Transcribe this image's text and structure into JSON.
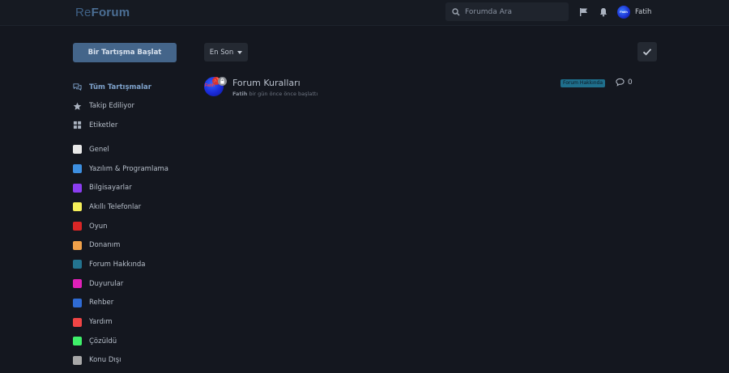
{
  "header": {
    "logo_re": "Re",
    "logo_forum": "Forum",
    "search_placeholder": "Forumda Ara",
    "user_name": "Fatih",
    "avatar_text": "Fatih"
  },
  "sidebar": {
    "start_button": "Bir Tartışma Başlat",
    "nav": [
      {
        "label": "Tüm Tartışmalar",
        "icon": "comments-icon",
        "active": true
      },
      {
        "label": "Takip Ediliyor",
        "icon": "star-icon",
        "active": false
      },
      {
        "label": "Etiketler",
        "icon": "grid-icon",
        "active": false
      }
    ],
    "tags": [
      {
        "label": "Genel",
        "color": "#e8e8e8"
      },
      {
        "label": "Yazılım & Programlama",
        "color": "#3d8fe0"
      },
      {
        "label": "Bilgisayarlar",
        "color": "#8b3df0"
      },
      {
        "label": "Akıllı Telefonlar",
        "color": "#f5ef5a"
      },
      {
        "label": "Oyun",
        "color": "#d92626"
      },
      {
        "label": "Donanım",
        "color": "#f0a14a"
      },
      {
        "label": "Forum Hakkında",
        "color": "#23738f"
      },
      {
        "label": "Duyurular",
        "color": "#e020b8"
      },
      {
        "label": "Rehber",
        "color": "#2f6bd4"
      },
      {
        "label": "Yardım",
        "color": "#f04545"
      },
      {
        "label": "Çözüldü",
        "color": "#3ff06a"
      },
      {
        "label": "Konu Dışı",
        "color": "#a8a8a8"
      }
    ]
  },
  "toolbar": {
    "sort_label": "En Son"
  },
  "discussions": [
    {
      "title": "Forum Kuralları",
      "author": "Fatih",
      "meta_suffix": " bir gün önce önce başlattı",
      "tag": "Forum Hakkında",
      "replies": "0",
      "pin_glyph": "📌"
    }
  ],
  "colors": {
    "accent": "#44658a",
    "background": "#14171f"
  }
}
